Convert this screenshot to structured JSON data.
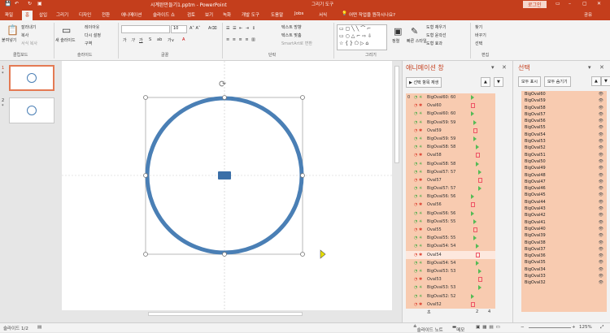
{
  "titlebar": {
    "title": "시계완만들기1.pptm  -  PowerPoint",
    "context_tab": "그리기 도구",
    "login": "로그인"
  },
  "tabs": [
    "파일",
    "홈",
    "삽입",
    "그리기",
    "디자인",
    "전환",
    "애니메이션",
    "슬라이드 쇼",
    "검토",
    "보기",
    "녹화",
    "개발 도구",
    "도움말",
    "Jobs",
    "서식"
  ],
  "tell_me": "어떤 작업을 원하시나요?",
  "share": "공유",
  "ribbon": {
    "paste": "붙여넣기",
    "cut": "잘라내기",
    "copy": "복사",
    "format_painter": "서식 복사",
    "new_slide": "새 슬라이드",
    "layout": "레이아웃",
    "reset": "다시 설정",
    "section": "구역",
    "font_size": "10",
    "bold": "가",
    "italic": "가",
    "underline": "가",
    "strike": "S",
    "text_dir": "텍스트 방향",
    "text_align": "텍스트 맞춤",
    "smartart": "SmartArt로 변환",
    "arrange": "정렬",
    "quick_styles": "빠른 스타일",
    "shape_fill": "도형 채우기",
    "shape_outline": "도형 윤곽선",
    "shape_effects": "도형 효과",
    "find": "찾기",
    "replace": "바꾸기",
    "select": "선택",
    "groups": {
      "clipboard": "클립보드",
      "slides": "슬라이드",
      "font": "글꼴",
      "paragraph": "단락",
      "drawing": "그리기",
      "editing": "편집"
    }
  },
  "thumbs": [
    {
      "num": "1",
      "star": "*"
    },
    {
      "num": "2",
      "star": "*"
    }
  ],
  "anim": {
    "title": "애니메이션 창",
    "play": "선택 항목 재생",
    "zoom": "초",
    "ticks": [
      "2",
      "4"
    ],
    "items": [
      {
        "num": "0",
        "label": "BigOval60: 60",
        "type": "star"
      },
      {
        "num": "",
        "label": "Oval60",
        "type": "star2"
      },
      {
        "num": "",
        "label": "BigOval60: 60",
        "type": "star"
      },
      {
        "num": "",
        "label": "BigOval59: 59",
        "type": "star"
      },
      {
        "num": "",
        "label": "Oval59",
        "type": "star2"
      },
      {
        "num": "",
        "label": "BigOval59: 59",
        "type": "star"
      },
      {
        "num": "",
        "label": "BigOval58: 58",
        "type": "star"
      },
      {
        "num": "",
        "label": "Oval58",
        "type": "star2"
      },
      {
        "num": "",
        "label": "BigOval58: 58",
        "type": "star"
      },
      {
        "num": "",
        "label": "BigOval57: 57",
        "type": "star"
      },
      {
        "num": "",
        "label": "Oval57",
        "type": "star2"
      },
      {
        "num": "",
        "label": "BigOval57: 57",
        "type": "star"
      },
      {
        "num": "",
        "label": "BigOval56: 56",
        "type": "star"
      },
      {
        "num": "",
        "label": "Oval56",
        "type": "star2"
      },
      {
        "num": "",
        "label": "BigOval56: 56",
        "type": "star"
      },
      {
        "num": "",
        "label": "BigOval55: 55",
        "type": "star"
      },
      {
        "num": "",
        "label": "Oval55",
        "type": "star2"
      },
      {
        "num": "",
        "label": "BigOval55: 55",
        "type": "star"
      },
      {
        "num": "",
        "label": "BigOval54: 54",
        "type": "star"
      },
      {
        "num": "",
        "label": "Oval54",
        "type": "star2"
      },
      {
        "num": "",
        "label": "BigOval54: 54",
        "type": "star"
      },
      {
        "num": "",
        "label": "BigOval53: 53",
        "type": "star"
      },
      {
        "num": "",
        "label": "Oval53",
        "type": "star2"
      },
      {
        "num": "",
        "label": "BigOval53: 53",
        "type": "star"
      },
      {
        "num": "",
        "label": "BigOval52: 52",
        "type": "star"
      },
      {
        "num": "",
        "label": "Oval52",
        "type": "star2"
      }
    ]
  },
  "selection": {
    "title": "선택",
    "show_all": "모두 표시",
    "hide_all": "모두 숨기기",
    "items": [
      "BigOval60",
      "BigOval59",
      "BigOval58",
      "BigOval57",
      "BigOval56",
      "BigOval55",
      "BigOval54",
      "BigOval53",
      "BigOval52",
      "BigOval51",
      "BigOval50",
      "BigOval49",
      "BigOval48",
      "BigOval47",
      "BigOval46",
      "BigOval45",
      "BigOval44",
      "BigOval43",
      "BigOval42",
      "BigOval41",
      "BigOval40",
      "BigOval39",
      "BigOval38",
      "BigOval37",
      "BigOval36",
      "BigOval35",
      "BigOval34",
      "BigOval33",
      "BigOval32"
    ]
  },
  "status": {
    "slide": "슬라이드 1/2",
    "notes": "슬라이드 노트",
    "memo": "메모",
    "zoom": "125%"
  },
  "colors": {
    "accent": "#c43e1c",
    "circle": "#4a7fb5",
    "pane_list": "#f8cbb0"
  }
}
